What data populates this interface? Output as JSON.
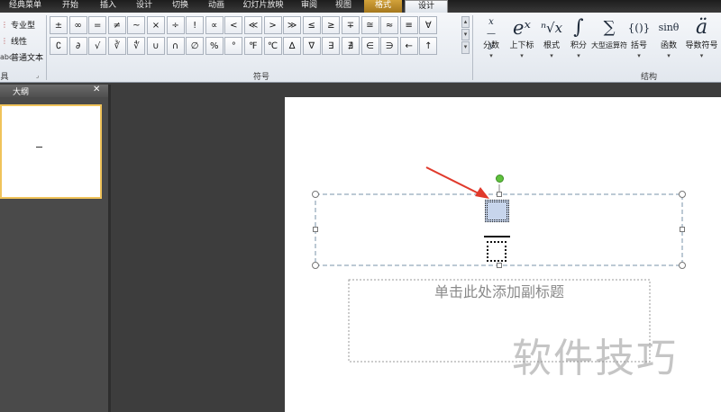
{
  "ribbon_tabs": [
    {
      "label": "经典菜单"
    },
    {
      "label": "开始"
    },
    {
      "label": "插入"
    },
    {
      "label": "设计"
    },
    {
      "label": "切换"
    },
    {
      "label": "动画"
    },
    {
      "label": "幻灯片放映"
    },
    {
      "label": "审阅"
    },
    {
      "label": "视图"
    },
    {
      "label": "格式"
    },
    {
      "label": "设计"
    }
  ],
  "tools_group": {
    "items": [
      "专业型",
      "线性",
      "普通文本"
    ],
    "label": "具"
  },
  "symbols_group": {
    "label": "符号",
    "symbols": [
      "±",
      "∞",
      "=",
      "≠",
      "~",
      "×",
      "÷",
      "!",
      "∝",
      "<",
      "≪",
      ">",
      "≫",
      "≤",
      "≥",
      "∓",
      "≅",
      "≈",
      "≡",
      "∀",
      "∁",
      "∂",
      "√",
      "∛",
      "∜",
      "∪",
      "∩",
      "∅",
      "%",
      "°",
      "℉",
      "℃",
      "∆",
      "∇",
      "∃",
      "∄",
      "∈",
      "∋",
      "←",
      "↑"
    ]
  },
  "structures_group": {
    "label": "结构",
    "items": [
      {
        "glyph": "x/y",
        "label": "分数"
      },
      {
        "glyph": "eˣ",
        "label": "上下标"
      },
      {
        "glyph": "ⁿ√x",
        "label": "根式"
      },
      {
        "glyph": "∫",
        "label": "积分"
      },
      {
        "glyph": "∑",
        "label": "大型运算符"
      },
      {
        "glyph": "{()}",
        "label": "括号"
      },
      {
        "glyph": "sinθ",
        "label": "函数"
      },
      {
        "glyph": "ä",
        "label": "导数符号"
      }
    ]
  },
  "outline_panel": {
    "tab_label": "大纲",
    "close_glyph": "✕"
  },
  "slide": {
    "subtitle_placeholder": "单击此处添加副标题"
  },
  "watermark": "软件技巧",
  "colors": {
    "arrow": "#e0392b",
    "rotate_handle": "#5fc23d",
    "selected_placeholder": "#c7d5ec",
    "context_tab": "#c39230"
  }
}
